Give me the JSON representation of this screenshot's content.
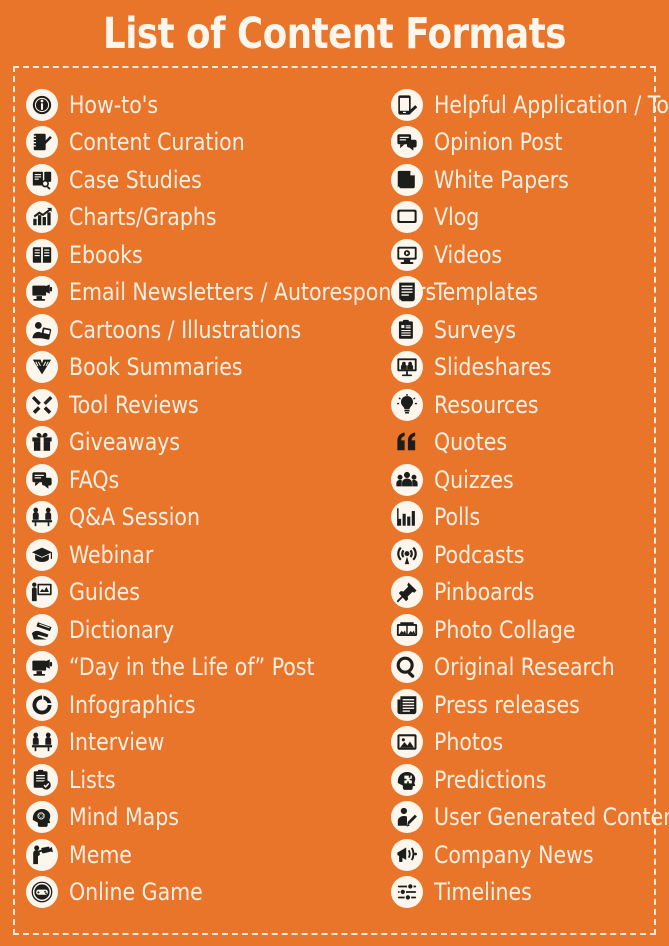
{
  "header": {
    "title": "List of Content Formats"
  },
  "colors": {
    "background": "#e8752a",
    "text": "#f7efe4",
    "icon_bg": "#fdf6ec",
    "icon_fg": "#1d1d1b",
    "border": "#fbeadb"
  },
  "columns": {
    "left": [
      {
        "label": "How-to's",
        "icon": "info-circle-icon"
      },
      {
        "label": "Content Curation",
        "icon": "notepad-pencil-icon"
      },
      {
        "label": "Case Studies",
        "icon": "document-magnifier-icon"
      },
      {
        "label": "Charts/Graphs",
        "icon": "bar-chart-arrow-icon"
      },
      {
        "label": "Ebooks",
        "icon": "open-book-icon"
      },
      {
        "label": "Email Newsletters / Autoresponders",
        "icon": "monitor-megaphone-icon"
      },
      {
        "label": "Cartoons / Illustrations",
        "icon": "person-picture-icon"
      },
      {
        "label": "Book Summaries",
        "icon": "book-v-icon"
      },
      {
        "label": "Tool Reviews",
        "icon": "tools-cross-icon"
      },
      {
        "label": "Giveaways",
        "icon": "gift-icon"
      },
      {
        "label": "FAQs",
        "icon": "speech-bubbles-icon"
      },
      {
        "label": "Q&A Session",
        "icon": "two-people-table-icon"
      },
      {
        "label": "Webinar",
        "icon": "graduation-cap-icon"
      },
      {
        "label": "Guides",
        "icon": "presenter-board-icon"
      },
      {
        "label": "Dictionary",
        "icon": "hand-book-icon"
      },
      {
        "label": "“Day in the Life of” Post",
        "icon": "monitor-megaphone-icon"
      },
      {
        "label": "Infographics",
        "icon": "donut-chart-icon"
      },
      {
        "label": "Interview",
        "icon": "two-people-table-icon"
      },
      {
        "label": "Lists",
        "icon": "checklist-icon"
      },
      {
        "label": "Mind Maps",
        "icon": "head-gear-icon"
      },
      {
        "label": "Meme",
        "icon": "person-camera-icon"
      },
      {
        "label": "Online Game",
        "icon": "gamepad-circle-icon"
      }
    ],
    "right": [
      {
        "label": "Helpful Application / Tool",
        "icon": "mobile-app-icon"
      },
      {
        "label": "Opinion Post",
        "icon": "speech-bubbles-icon"
      },
      {
        "label": "White Papers",
        "icon": "paper-sheet-icon"
      },
      {
        "label": "Vlog",
        "icon": "screen-icon"
      },
      {
        "label": "Videos",
        "icon": "monitor-play-icon"
      },
      {
        "label": "Templates",
        "icon": "lined-document-icon"
      },
      {
        "label": "Surveys",
        "icon": "clipboard-icon"
      },
      {
        "label": "Slideshares",
        "icon": "presentation-people-icon"
      },
      {
        "label": "Resources",
        "icon": "lightbulb-icon"
      },
      {
        "label": "Quotes",
        "icon": "quotation-mark-icon"
      },
      {
        "label": "Quizzes",
        "icon": "group-people-icon"
      },
      {
        "label": "Polls",
        "icon": "bar-chart-icon"
      },
      {
        "label": "Podcasts",
        "icon": "podcast-signal-icon"
      },
      {
        "label": "Pinboards",
        "icon": "pushpin-icon"
      },
      {
        "label": "Photo Collage",
        "icon": "photo-frames-icon"
      },
      {
        "label": "Original Research",
        "icon": "magnifier-icon"
      },
      {
        "label": "Press releases",
        "icon": "newspaper-icon"
      },
      {
        "label": "Photos",
        "icon": "image-icon"
      },
      {
        "label": "Predictions",
        "icon": "head-puzzle-icon"
      },
      {
        "label": "User Generated Content",
        "icon": "person-edit-icon"
      },
      {
        "label": "Company News",
        "icon": "megaphone-icon"
      },
      {
        "label": "Timelines",
        "icon": "sliders-icon"
      }
    ]
  }
}
